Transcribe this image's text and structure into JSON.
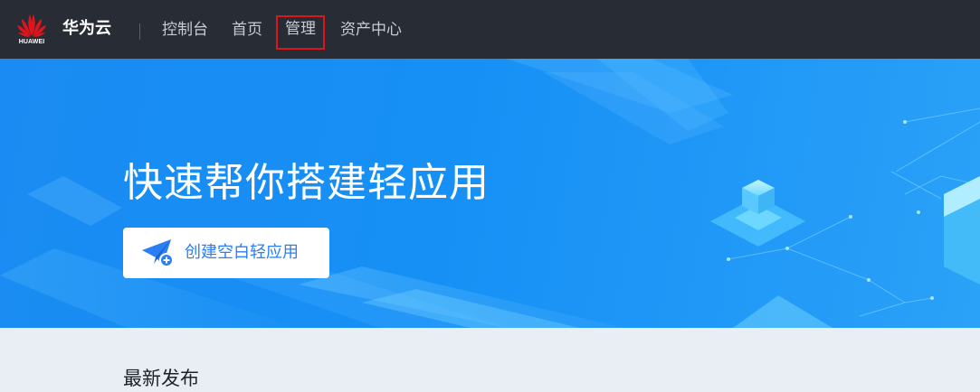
{
  "header": {
    "logo_text": "HUAWEI",
    "cloud_name": "华为云",
    "nav": [
      {
        "label": "控制台"
      },
      {
        "label": "首页"
      },
      {
        "label": "管理"
      },
      {
        "label": "资产中心"
      }
    ]
  },
  "hero": {
    "title": "快速帮你搭建轻应用",
    "create_button_label": "创建空白轻应用"
  },
  "section": {
    "title": "最新发布"
  },
  "colors": {
    "topbar_bg": "#282c35",
    "hero_blue": "#1a8bf2",
    "accent": "#2b7ff3",
    "highlight_box": "#e0151b",
    "brand_red": "#e0151b"
  },
  "icons": {
    "logo": "huawei-petal-logo",
    "create_button": "paper-plane-add-icon"
  }
}
